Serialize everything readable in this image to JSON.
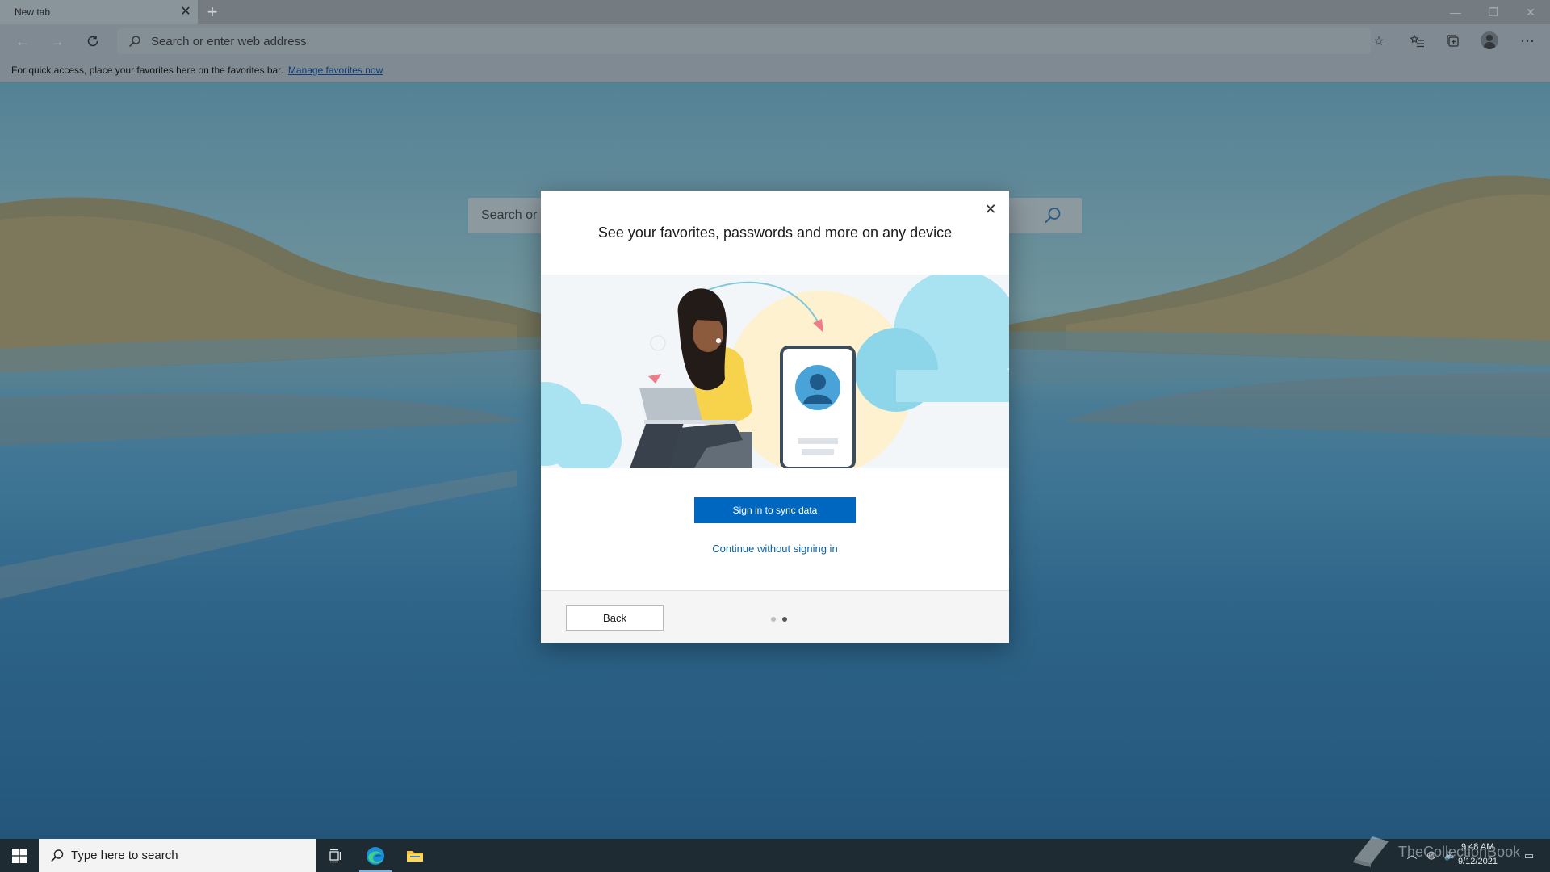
{
  "browser": {
    "tab": {
      "title": "New tab"
    },
    "address_bar": {
      "placeholder": "Search or enter web address"
    },
    "favorites_bar": {
      "message": "For quick access, place your favorites here on the favorites bar.",
      "link": "Manage favorites now"
    }
  },
  "new_tab_page": {
    "search_placeholder": "Search or e"
  },
  "dialog": {
    "title": "See your favorites, passwords and more on any device",
    "primary_button": "Sign in to sync data",
    "secondary_link": "Continue without signing in",
    "back_button": "Back",
    "pager": {
      "total": 2,
      "current": 2
    }
  },
  "taskbar": {
    "search_placeholder": "Type here to search",
    "clock": {
      "time": "9:48 AM",
      "date": "9/12/2021"
    },
    "watermark": "TheCollectionBook"
  },
  "icons": {
    "tab_close": "close-icon",
    "new_tab": "plus-icon",
    "back": "arrow-left-icon",
    "forward": "arrow-right-icon",
    "refresh": "refresh-icon",
    "address_search": "search-icon",
    "favorite": "star-icon",
    "favorites_hub": "favorites-list-icon",
    "collections": "collections-icon",
    "profile": "profile-icon",
    "more": "more-icon",
    "start": "windows-logo-icon",
    "task_view": "task-view-icon",
    "edge": "edge-icon",
    "explorer": "folder-icon"
  },
  "colors": {
    "primary_button": "#0067c0",
    "link": "#0a60a8",
    "pager_active": "#555555",
    "pager_inactive": "#bdbdbd"
  }
}
